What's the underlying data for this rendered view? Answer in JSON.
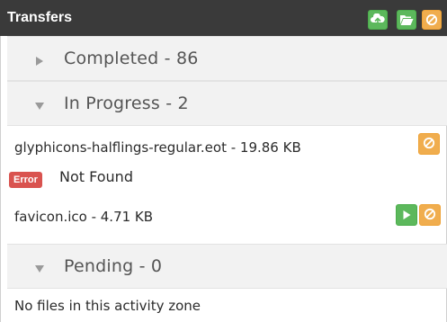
{
  "header": {
    "title": "Transfers",
    "icons": [
      "cloud-upload-icon",
      "folder-open-icon",
      "cancel-icon"
    ]
  },
  "sections": {
    "completed": {
      "label": "Completed - 86",
      "expanded": false
    },
    "in_progress": {
      "label": "In Progress - 2",
      "expanded": true
    },
    "pending": {
      "label": "Pending - 0",
      "expanded": true
    }
  },
  "files": [
    {
      "name": "glyphicons-halflings-regular.eot - 19.86 KB",
      "status_badge": "Error",
      "status_message": "Not Found",
      "actions": [
        "cancel"
      ]
    },
    {
      "name": "favicon.ico - 4.71 KB",
      "actions": [
        "start",
        "cancel"
      ]
    }
  ],
  "pending_empty": "No files in this activity zone",
  "colors": {
    "header_bg": "#3a3a3a",
    "green": "#5cb85c",
    "orange": "#f0ad4e",
    "error_red": "#d9534f",
    "section_bg": "#f2f2f2"
  }
}
